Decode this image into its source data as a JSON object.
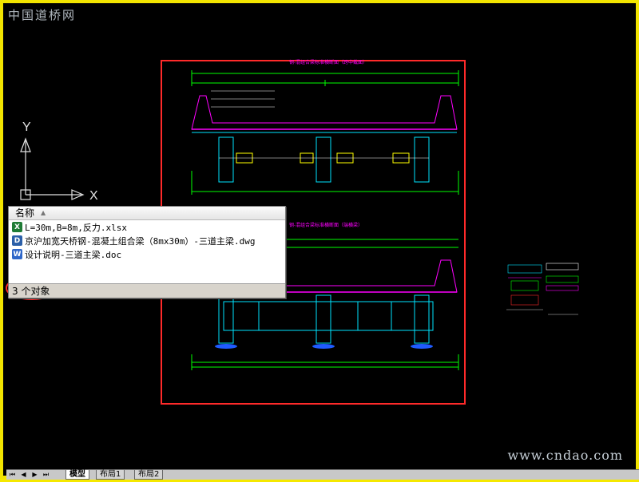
{
  "watermark_top": "中国道桥网",
  "watermark_bottom": "www.cndao.com",
  "axis": {
    "y_label": "Y",
    "x_label": "X"
  },
  "drawing": {
    "section_top_title": "钢-混组合梁标准横断面（跨中截面）",
    "section_bottom_title": "钢-混组合梁标准横断面（端横梁）",
    "colors": {
      "highlight_red": "#ff2a2a",
      "cad_green": "#00ff00",
      "cad_cyan": "#00e5ff",
      "cad_magenta": "#ff00ff",
      "cad_yellow": "#ffff00"
    }
  },
  "file_panel": {
    "header": "名称",
    "files": [
      {
        "icon": "excel-icon",
        "name": "L=30m,B=8m,反力.xlsx"
      },
      {
        "icon": "dwg-icon",
        "name": "京沪加宽天桥钢-混凝土组合梁（8mx30m）-三道主梁.dwg"
      },
      {
        "icon": "word-icon",
        "name": "设计说明-三道主梁.doc"
      }
    ],
    "status": "3 个对象"
  },
  "layout_tabs": {
    "tabs": [
      "模型",
      "布局1",
      "布局2"
    ],
    "active": "模型"
  }
}
